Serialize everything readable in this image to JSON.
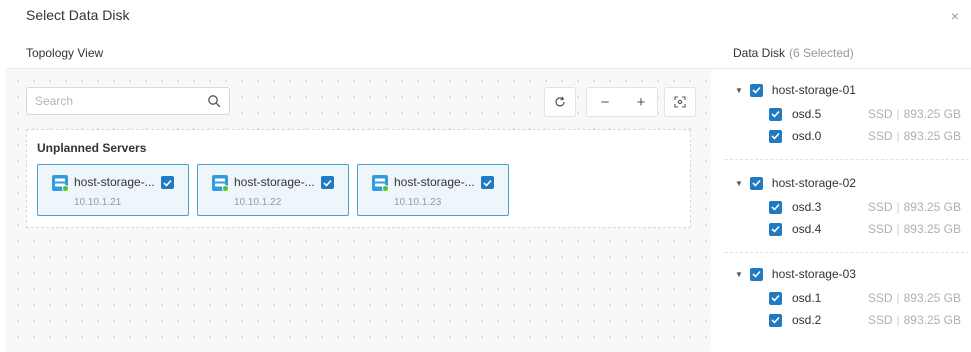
{
  "dialog": {
    "title": "Select Data Disk",
    "close_icon": "×"
  },
  "topology": {
    "title": "Topology View",
    "search": {
      "placeholder": "Search",
      "value": ""
    },
    "toolbar": {
      "refresh_icon": "refresh-icon",
      "zoom_out_label": "−",
      "zoom_in_label": "+",
      "fit_icon": "fit-screen-icon"
    },
    "group": {
      "title": "Unplanned Servers",
      "servers": [
        {
          "name": "host-storage-...",
          "ip": "10.10.1.21",
          "checked": true
        },
        {
          "name": "host-storage-...",
          "ip": "10.10.1.22",
          "checked": true
        },
        {
          "name": "host-storage-...",
          "ip": "10.10.1.23",
          "checked": true
        }
      ]
    }
  },
  "data_disk": {
    "title": "Data Disk",
    "selected_label": "(6 Selected)",
    "hosts": [
      {
        "name": "host-storage-01",
        "disks": [
          {
            "name": "osd.5",
            "type": "SSD",
            "size": "893.25 GB"
          },
          {
            "name": "osd.0",
            "type": "SSD",
            "size": "893.25 GB"
          }
        ]
      },
      {
        "name": "host-storage-02",
        "disks": [
          {
            "name": "osd.3",
            "type": "SSD",
            "size": "893.25 GB"
          },
          {
            "name": "osd.4",
            "type": "SSD",
            "size": "893.25 GB"
          }
        ]
      },
      {
        "name": "host-storage-03",
        "disks": [
          {
            "name": "osd.1",
            "type": "SSD",
            "size": "893.25 GB"
          },
          {
            "name": "osd.2",
            "type": "SSD",
            "size": "893.25 GB"
          }
        ]
      }
    ]
  },
  "colors": {
    "accent": "#1f7ac2",
    "card_border": "#4a9fd0",
    "card_bg": "#eef5fb",
    "server_icon": "#2f9ee0",
    "status_dot": "#52c41a"
  }
}
